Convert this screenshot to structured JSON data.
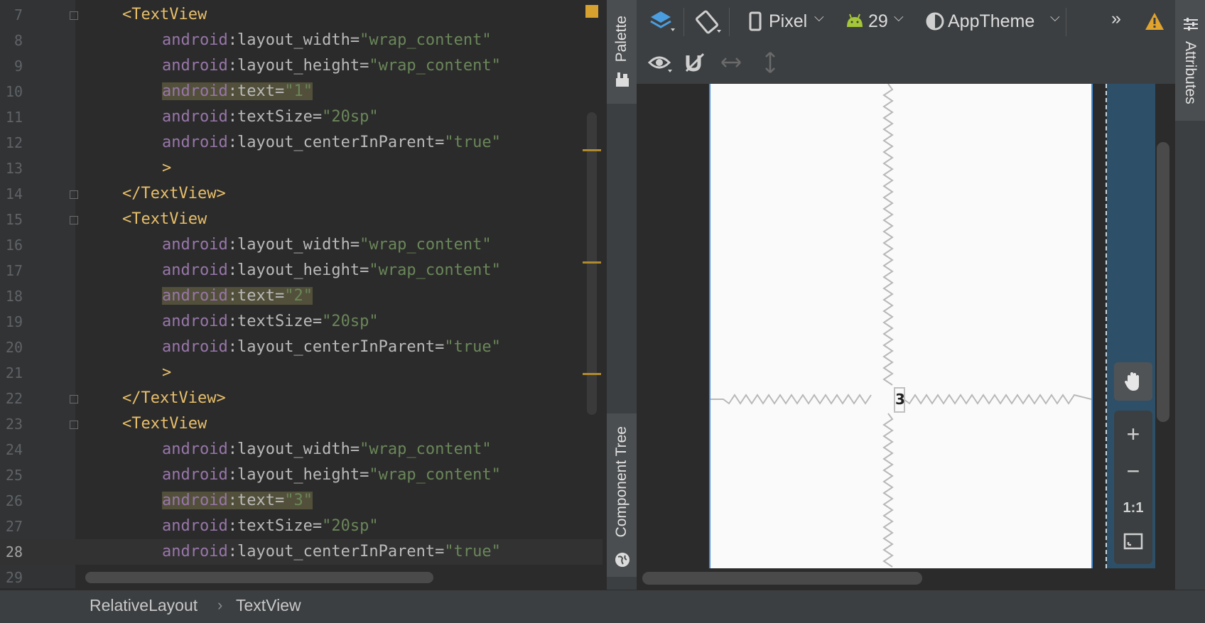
{
  "editor": {
    "lines": [
      {
        "n": "7",
        "parts": [
          {
            "c": "tag",
            "t": "<TextView"
          }
        ],
        "indent": 1,
        "fold": true
      },
      {
        "n": "8",
        "parts": [
          {
            "c": "ns",
            "t": "android"
          },
          {
            "c": "attr",
            "t": ":layout_width="
          },
          {
            "c": "val",
            "t": "\"wrap_content\""
          }
        ],
        "indent": 2
      },
      {
        "n": "9",
        "parts": [
          {
            "c": "ns",
            "t": "android"
          },
          {
            "c": "attr",
            "t": ":layout_height="
          },
          {
            "c": "val",
            "t": "\"wrap_content\""
          }
        ],
        "indent": 2
      },
      {
        "n": "10",
        "parts": [
          {
            "c": "ns hl",
            "t": "android"
          },
          {
            "c": "attr hl",
            "t": ":text="
          },
          {
            "c": "val hl",
            "t": "\"1\""
          }
        ],
        "indent": 2
      },
      {
        "n": "11",
        "parts": [
          {
            "c": "ns",
            "t": "android"
          },
          {
            "c": "attr",
            "t": ":textSize="
          },
          {
            "c": "val",
            "t": "\"20sp\""
          }
        ],
        "indent": 2
      },
      {
        "n": "12",
        "parts": [
          {
            "c": "ns",
            "t": "android"
          },
          {
            "c": "attr",
            "t": ":layout_centerInParent="
          },
          {
            "c": "val",
            "t": "\"true\""
          }
        ],
        "indent": 2
      },
      {
        "n": "13",
        "parts": [
          {
            "c": "tag",
            "t": ">"
          }
        ],
        "indent": 2
      },
      {
        "n": "14",
        "parts": [
          {
            "c": "tag",
            "t": "</TextView>"
          }
        ],
        "indent": 1,
        "fold": true
      },
      {
        "n": "15",
        "parts": [
          {
            "c": "tag",
            "t": "<TextView"
          }
        ],
        "indent": 1,
        "fold": true
      },
      {
        "n": "16",
        "parts": [
          {
            "c": "ns",
            "t": "android"
          },
          {
            "c": "attr",
            "t": ":layout_width="
          },
          {
            "c": "val",
            "t": "\"wrap_content\""
          }
        ],
        "indent": 2
      },
      {
        "n": "17",
        "parts": [
          {
            "c": "ns",
            "t": "android"
          },
          {
            "c": "attr",
            "t": ":layout_height="
          },
          {
            "c": "val",
            "t": "\"wrap_content\""
          }
        ],
        "indent": 2
      },
      {
        "n": "18",
        "parts": [
          {
            "c": "ns hl",
            "t": "android"
          },
          {
            "c": "attr hl",
            "t": ":text="
          },
          {
            "c": "val hl",
            "t": "\"2\""
          }
        ],
        "indent": 2
      },
      {
        "n": "19",
        "parts": [
          {
            "c": "ns",
            "t": "android"
          },
          {
            "c": "attr",
            "t": ":textSize="
          },
          {
            "c": "val",
            "t": "\"20sp\""
          }
        ],
        "indent": 2
      },
      {
        "n": "20",
        "parts": [
          {
            "c": "ns",
            "t": "android"
          },
          {
            "c": "attr",
            "t": ":layout_centerInParent="
          },
          {
            "c": "val",
            "t": "\"true\""
          }
        ],
        "indent": 2
      },
      {
        "n": "21",
        "parts": [
          {
            "c": "tag",
            "t": ">"
          }
        ],
        "indent": 2
      },
      {
        "n": "22",
        "parts": [
          {
            "c": "tag",
            "t": "</TextView>"
          }
        ],
        "indent": 1,
        "fold": true
      },
      {
        "n": "23",
        "parts": [
          {
            "c": "tag",
            "t": "<TextView"
          }
        ],
        "indent": 1,
        "fold": true
      },
      {
        "n": "24",
        "parts": [
          {
            "c": "ns",
            "t": "android"
          },
          {
            "c": "attr",
            "t": ":layout_width="
          },
          {
            "c": "val",
            "t": "\"wrap_content\""
          }
        ],
        "indent": 2
      },
      {
        "n": "25",
        "parts": [
          {
            "c": "ns",
            "t": "android"
          },
          {
            "c": "attr",
            "t": ":layout_height="
          },
          {
            "c": "val",
            "t": "\"wrap_content\""
          }
        ],
        "indent": 2
      },
      {
        "n": "26",
        "parts": [
          {
            "c": "ns hl",
            "t": "android"
          },
          {
            "c": "attr hl",
            "t": ":text="
          },
          {
            "c": "val hl",
            "t": "\"3\""
          }
        ],
        "indent": 2
      },
      {
        "n": "27",
        "parts": [
          {
            "c": "ns",
            "t": "android"
          },
          {
            "c": "attr",
            "t": ":textSize="
          },
          {
            "c": "val",
            "t": "\"20sp\""
          }
        ],
        "indent": 2
      },
      {
        "n": "28",
        "parts": [
          {
            "c": "ns",
            "t": "android"
          },
          {
            "c": "attr",
            "t": ":layout_centerInParent="
          },
          {
            "c": "val",
            "t": "\"true\""
          }
        ],
        "indent": 2,
        "current": true
      },
      {
        "n": "29",
        "parts": [],
        "indent": 1
      }
    ]
  },
  "side_tabs": {
    "palette": "Palette",
    "component_tree": "Component Tree",
    "attributes": "Attributes"
  },
  "toolbar": {
    "device": "Pixel",
    "api_level": "29",
    "theme": "AppTheme",
    "overflow": "»"
  },
  "preview": {
    "overlapping_text": "3"
  },
  "zoom": {
    "zoom_in": "+",
    "zoom_out": "−",
    "actual_size": "1:1"
  },
  "breadcrumb": {
    "items": [
      "RelativeLayout",
      "TextView"
    ]
  },
  "colors": {
    "tag": "#e8bf6a",
    "namespace": "#9876aa",
    "attribute": "#bababa",
    "value": "#6a8759",
    "warning": "#e0a32e",
    "android_green": "#a4c639",
    "layers_blue": "#4a9ee0"
  }
}
